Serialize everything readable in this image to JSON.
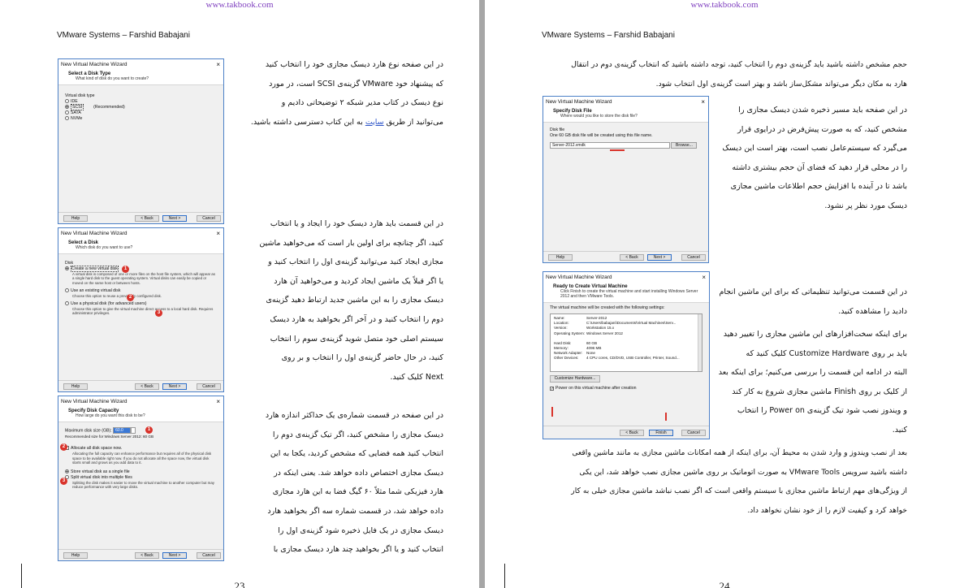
{
  "watermark": "www.takbook.com",
  "header": "VMware Systems – Farshid Babajani",
  "left_page": {
    "page_number": "23",
    "para1": [
      "در این صفحه نوع هارد دیسک مجازی خود را انتخاب کنید",
      "که پیشنهاد خود VMware گزینه‌ی SCSI است، در مورد",
      "نوع دیسک در کتاب مدیر شبکه ۲ توضیحاتی دادیم و",
      "می‌توانید از طریق سایت به این کتاب دسترسی داشته باشید."
    ],
    "link_text": "سایت",
    "para2": [
      "در این قسمت باید هارد دیسک خود را ایجاد و یا انتخاب",
      "کنید، اگر چنانچه برای اولین بار است که می‌خواهید ماشین",
      "مجازی ایجاد کنید می‌توانید گزینه‌ی اول را انتخاب کنید و",
      "یا اگر قبلاً یک ماشین ایجاد کردید و می‌خواهید آن هارد",
      "دیسک مجازی را به این ماشین جدید ارتباط دهید گزینه‌ی",
      "دوم را انتخاب کنید و در آخر اگر بخواهید به هارد دیسک",
      "سیستم اصلی خود متصل شوید گزینه‌ی سوم را انتخاب",
      "کنید، در حال حاضر گزینه‌ی اول را انتخاب و بر روی",
      "Next کلیک کنید."
    ],
    "para3": [
      "در این صفحه در قسمت شماره‌ی یک حداکثر اندازه هارد",
      "دیسک مجازی را مشخص کنید، اگر تیک گزینه‌ی دوم را",
      "انتخاب کنید همه فضایی که مشخص کردید، یکجا به این",
      "دیسک مجازی اختصاص داده خواهد شد. یعنی اینکه در",
      "هارد فیزیکی شما مثلاً ۶۰ گیگ فضا به این هارد مجازی",
      "داده خواهد شد، در قسمت شماره سه اگر بخواهید هارد",
      "دیسک مجازی در یک فایل ذخیره شود گزینه‌ی اول را",
      "انتخاب کنید و یا اگر بخواهید چند هارد دیسک مجازی با"
    ]
  },
  "right_page": {
    "page_number": "24",
    "para1": [
      "حجم مشخص داشته باشید باید گزینه‌ی دوم را انتخاب کنید، توجه داشته باشید که انتخاب گزینه‌ی دوم در انتقال",
      "هارد به مکان دیگر می‌تواند مشکل‌ساز باشد و بهتر است گزینه‌ی اول انتخاب شود."
    ],
    "para2": [
      "در این صفحه باید مسیر ذخیره شدن دیسک مجازی را",
      "مشخص کنید، که به صورت پیش‌فرض در درایوی قرار",
      "می‌گیرد که سیستم‌عامل نصب است، بهتر است این دیسک",
      "را در محلی قرار دهید که فضای آن حجم بیشتری داشته",
      "باشد تا در آینده با افزایش حجم اطلاعات ماشین مجازی",
      "دیسک مورد نظر پر نشود."
    ],
    "para3": [
      "در این قسمت می‌توانید تنظیماتی که برای این ماشین انجام",
      "دادید را مشاهده کنید."
    ],
    "para4": [
      "برای اینکه سخت‌افزارهای این ماشین مجازی را تغییر دهید",
      "باید بر روی Customize Hardware کلیک کنید که",
      "البته در ادامه این قسمت را بررسی می‌کنیم؛ برای اینکه بعد",
      "از کلیک بر روی Finish ماشین مجازی شروع به کار کند",
      "و ویندوز نصب شود تیک گزینه‌ی Power on را انتخاب",
      "کنید."
    ],
    "para5": [
      "بعد از نصب ویندوز و وارد شدن به محیط آن، برای اینکه از همه امکانات ماشین مجازی به مانند ماشین واقعی",
      "داشته باشید سرویس VMware Tools به صورت اتوماتیک بر روی ماشین مجازی نصب خواهد شد، این یکی",
      "از ویژگی‌های مهم ارتباط ماشین مجازی با سیستم واقعی است که اگر نصب نباشد ماشین مجازی خیلی به کار",
      "خواهد کرد و کیفیت لازم را از خود نشان نخواهد داد."
    ]
  },
  "dialog_common": {
    "window_title": "New Virtual Machine Wizard",
    "close": "×",
    "help": "Help",
    "back": "< Back",
    "next": "Next >",
    "cancel": "Cancel",
    "finish": "Finish"
  },
  "dlg_disk_type": {
    "heading": "Select a Disk Type",
    "subheading": "What kind of disk do you want to create?",
    "group_label": "Virtual disk type",
    "options": [
      "IDE",
      "SCSI",
      "SATA",
      "NVMe"
    ],
    "recommended": "(Recommended)",
    "selected": "SCSI"
  },
  "dlg_select_disk": {
    "heading": "Select a Disk",
    "subheading": "Which disk do you want to use?",
    "group_label": "Disk",
    "opt1": "Create a new virtual disk",
    "opt1_desc": "A virtual disk is composed of one or more files on the host file system, which will appear as a single hard disk to the guest operating system. Virtual disks can easily be copied or moved on the same host or between hosts.",
    "opt2": "Use an existing virtual disk",
    "opt2_desc": "Choose this option to reuse a previously configured disk.",
    "opt3": "Use a physical disk (for advanced users)",
    "opt3_desc": "Choose this option to give the virtual machine direct access to a local hard disk. Requires administrator privileges.",
    "badges": [
      "1",
      "2",
      "3"
    ]
  },
  "dlg_capacity": {
    "heading": "Specify Disk Capacity",
    "subheading": "How large do you want this disk to be?",
    "size_label": "Maximum disk size (GB):",
    "size_value": "60.0",
    "recommended": "Recommended size for Windows Server 2012: 60 GB",
    "allocate": "Allocate all disk space now.",
    "allocate_desc": "Allocating the full capacity can enhance performance but requires all of the physical disk space to be available right now. If you do not allocate all the space now, the virtual disk starts small and grows as you add data to it.",
    "single": "Store virtual disk as a single file",
    "split": "Split virtual disk into multiple files",
    "split_desc": "Splitting the disk makes it easier to move the virtual machine to another computer but may reduce performance with very large disks.",
    "badges": [
      "1",
      "2",
      "3"
    ]
  },
  "dlg_disk_file": {
    "heading": "Specify Disk File",
    "subheading": "Where would you like to store the disk file?",
    "group_label": "Disk file",
    "info": "One 60 GB disk file will be created using this file name.",
    "file_value": "Server-2012.vmdk",
    "browse": "Browse..."
  },
  "dlg_ready": {
    "heading": "Ready to Create Virtual Machine",
    "subheading": "Click Finish to create the virtual machine and start installing Windows Server 2012 and then VMware Tools.",
    "intro": "The virtual machine will be created with the following settings:",
    "settings": [
      {
        "k": "Name:",
        "v": "Server-2012"
      },
      {
        "k": "Location:",
        "v": "C:\\Users\\babajani\\Documents\\Virtual Machines\\Serv..."
      },
      {
        "k": "Version:",
        "v": "Workstation 15.x"
      },
      {
        "k": "Operating System:",
        "v": "Windows Server 2012"
      },
      {
        "k": "",
        "v": ""
      },
      {
        "k": "Hard Disk:",
        "v": "60 GB"
      },
      {
        "k": "Memory:",
        "v": "4096 MB"
      },
      {
        "k": "Network Adapter:",
        "v": "None"
      },
      {
        "k": "Other Devices:",
        "v": "4 CPU cores, CD/DVD, USB Controller, Printer, Sound..."
      }
    ],
    "customize": "Customize Hardware...",
    "power_on": "Power on this virtual machine after creation"
  }
}
